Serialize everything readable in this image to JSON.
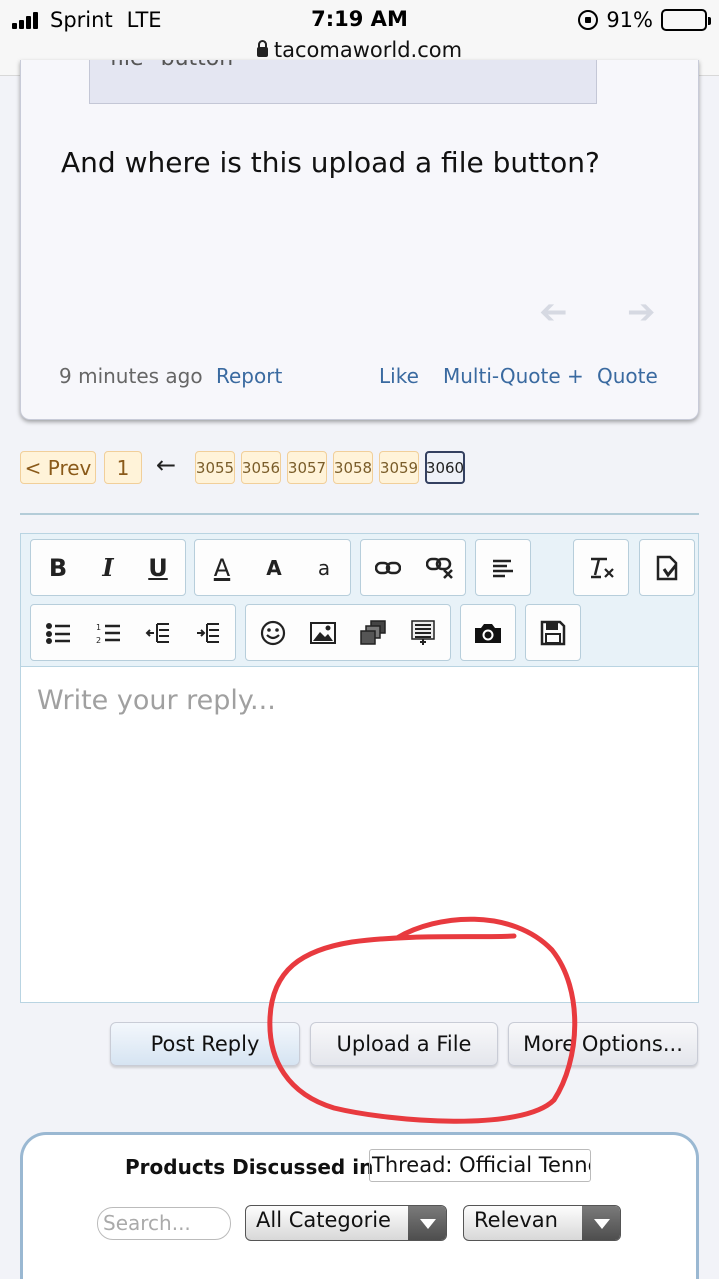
{
  "status_bar": {
    "carrier": "Sprint",
    "network": "LTE",
    "time": "7:19 AM",
    "battery": "91%",
    "battery_level": 0.91,
    "url": "tacomaworld.com"
  },
  "post": {
    "quoted_text": "file\" button",
    "text": "And where is this upload a file button?",
    "time": "9 minutes ago",
    "report": "Report",
    "like": "Like",
    "multi_quote": "Multi-Quote +",
    "quote": "Quote"
  },
  "pagination": {
    "prev": "< Prev",
    "first": "1",
    "jump_arrow": "←",
    "pages": [
      "3055",
      "3056",
      "3057",
      "3058",
      "3059",
      "3060"
    ],
    "current": "3060"
  },
  "editor": {
    "bold": "B",
    "italic": "I",
    "underline": "U",
    "font_color": "A",
    "font_size": "A",
    "font_family": "a",
    "placeholder": "Write your reply..."
  },
  "actions": {
    "post_reply": "Post Reply",
    "upload_file": "Upload a File",
    "more_options": "More Options..."
  },
  "products": {
    "label": "Products Discussed in",
    "thread_value": "Thread: Official Tenne",
    "search_placeholder": "Search...",
    "category_select": "All Categorie",
    "sort_select": "Relevan"
  },
  "colors": {
    "link": "#3a6aa0",
    "annotation_red": "#e83a3f",
    "pager_fill": "#fff3d9"
  }
}
